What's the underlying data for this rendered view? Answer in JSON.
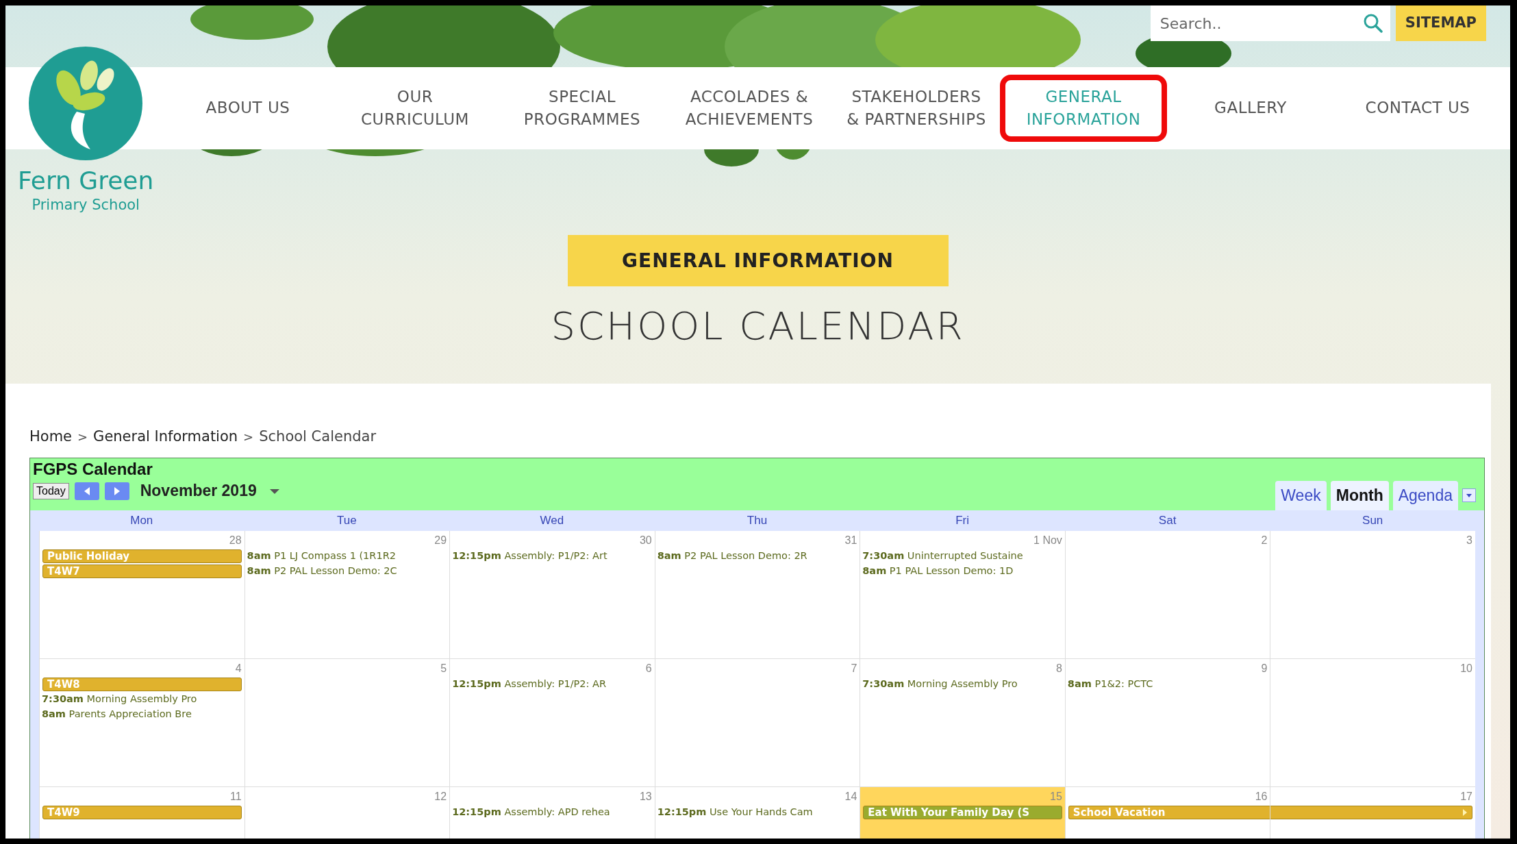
{
  "header": {
    "search": {
      "placeholder": "Search.."
    },
    "sitemap": "SITEMAP",
    "school_name": "Fern Green",
    "school_subtitle": "Primary School",
    "nav": [
      {
        "label": "ABOUT US",
        "selected": false,
        "highlighted": false
      },
      {
        "label": "OUR CURRICULUM",
        "selected": false,
        "highlighted": false
      },
      {
        "label": "SPECIAL PROGRAMMES",
        "selected": false,
        "highlighted": false
      },
      {
        "label": "ACCOLADES & ACHIEVEMENTS",
        "selected": false,
        "highlighted": false
      },
      {
        "label": "STAKEHOLDERS & PARTNERSHIPS",
        "selected": false,
        "highlighted": false
      },
      {
        "label": "GENERAL INFORMATION",
        "selected": true,
        "highlighted": true
      },
      {
        "label": "GALLERY",
        "selected": false,
        "highlighted": false
      },
      {
        "label": "CONTACT US",
        "selected": false,
        "highlighted": false
      }
    ]
  },
  "page_banner": "GENERAL INFORMATION",
  "page_title": "SCHOOL CALENDAR",
  "breadcrumb": [
    {
      "kind": "link",
      "label": "Home"
    },
    {
      "kind": "separator",
      "label": ">"
    },
    {
      "kind": "link",
      "label": "General Information"
    },
    {
      "kind": "separator",
      "label": ">"
    },
    {
      "kind": "current",
      "label": "School Calendar"
    }
  ],
  "calendar": {
    "title": "FGPS Calendar",
    "today_button": "Today",
    "month_label": "November 2019",
    "views": [
      {
        "label": "Week",
        "selected": false
      },
      {
        "label": "Month",
        "selected": true
      },
      {
        "label": "Agenda",
        "selected": false
      }
    ],
    "weekdays": [
      "Mon",
      "Tue",
      "Wed",
      "Thu",
      "Fri",
      "Sat",
      "Sun"
    ],
    "weeks": [
      {
        "days": [
          {
            "date": "28",
            "today": false,
            "events": [
              {
                "kind": "allday",
                "title": "Public Holiday",
                "color": "#e0b22d"
              },
              {
                "kind": "allday",
                "title": "T4W7",
                "color": "#e0b22d"
              }
            ]
          },
          {
            "date": "29",
            "today": false,
            "events": [
              {
                "kind": "timed",
                "time": "8am",
                "title": "P1 LJ Compass 1 (1R1R2"
              },
              {
                "kind": "timed",
                "time": "8am",
                "title": "P2 PAL Lesson Demo: 2C"
              }
            ]
          },
          {
            "date": "30",
            "today": false,
            "events": [
              {
                "kind": "timed",
                "time": "12:15pm",
                "title": "Assembly: P1/P2: Art"
              }
            ]
          },
          {
            "date": "31",
            "today": false,
            "events": [
              {
                "kind": "timed",
                "time": "8am",
                "title": "P2 PAL Lesson Demo: 2R"
              }
            ]
          },
          {
            "date": "1 Nov",
            "today": false,
            "events": [
              {
                "kind": "timed",
                "time": "7:30am",
                "title": "Uninterrupted Sustaine"
              },
              {
                "kind": "timed",
                "time": "8am",
                "title": "P1 PAL Lesson Demo: 1D"
              }
            ]
          },
          {
            "date": "2",
            "today": false
          },
          {
            "date": "3",
            "today": false
          }
        ]
      },
      {
        "days": [
          {
            "date": "4",
            "today": false,
            "events": [
              {
                "kind": "allday",
                "title": "T4W8",
                "color": "#e0b22d"
              },
              {
                "kind": "timed",
                "time": "7:30am",
                "title": "Morning Assembly Pro"
              },
              {
                "kind": "timed",
                "time": "8am",
                "title": "Parents Appreciation Bre"
              }
            ]
          },
          {
            "date": "5",
            "today": false
          },
          {
            "date": "6",
            "today": false,
            "events": [
              {
                "kind": "timed",
                "time": "12:15pm",
                "title": "Assembly: P1/P2: AR"
              }
            ]
          },
          {
            "date": "7",
            "today": false
          },
          {
            "date": "8",
            "today": false,
            "events": [
              {
                "kind": "timed",
                "time": "7:30am",
                "title": "Morning Assembly Pro"
              }
            ]
          },
          {
            "date": "9",
            "today": false,
            "events": [
              {
                "kind": "timed",
                "time": "8am",
                "title": "P1&2: PCTC"
              }
            ]
          },
          {
            "date": "10",
            "today": false
          }
        ]
      },
      {
        "days": [
          {
            "date": "11",
            "today": false,
            "events": [
              {
                "kind": "allday",
                "title": "T4W9",
                "color": "#e0b22d"
              }
            ]
          },
          {
            "date": "12",
            "today": false
          },
          {
            "date": "13",
            "today": false,
            "events": [
              {
                "kind": "timed",
                "time": "12:15pm",
                "title": "Assembly: APD rehea"
              }
            ]
          },
          {
            "date": "14",
            "today": false,
            "events": [
              {
                "kind": "timed",
                "time": "12:15pm",
                "title": "Use Your Hands Cam"
              }
            ]
          },
          {
            "date": "15",
            "today": true,
            "events": [
              {
                "kind": "allday",
                "title": "Eat With Your Family Day (S",
                "color": "#9aab2e"
              }
            ]
          },
          {
            "date": "16",
            "today": false,
            "events": [
              {
                "kind": "multiday",
                "title": "School Vacation",
                "color": "#e0b22d"
              }
            ]
          },
          {
            "date": "17",
            "today": false
          }
        ]
      }
    ]
  }
}
